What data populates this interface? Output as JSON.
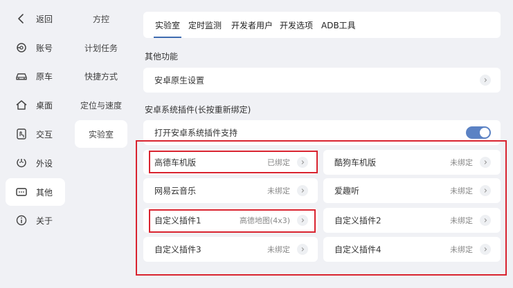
{
  "nav": {
    "items": [
      {
        "label": "返回",
        "icon": "back-icon"
      },
      {
        "label": "账号",
        "icon": "account-icon"
      },
      {
        "label": "原车",
        "icon": "car-icon"
      },
      {
        "label": "桌面",
        "icon": "home-icon"
      },
      {
        "label": "交互",
        "icon": "interaction-icon"
      },
      {
        "label": "外设",
        "icon": "peripheral-icon"
      },
      {
        "label": "其他",
        "icon": "other-icon",
        "active": true
      },
      {
        "label": "关于",
        "icon": "info-icon"
      }
    ]
  },
  "subnav": {
    "items": [
      {
        "label": "方控"
      },
      {
        "label": "计划任务"
      },
      {
        "label": "快捷方式"
      },
      {
        "label": "定位与速度"
      },
      {
        "label": "实验室",
        "active": true
      }
    ]
  },
  "tabs": [
    {
      "label": "实验室",
      "active": true
    },
    {
      "label": "定时监测"
    },
    {
      "label": "开发者用户"
    },
    {
      "label": "开发选项"
    },
    {
      "label": "ADB工具"
    }
  ],
  "other_functions": {
    "title": "其他功能",
    "android_native_settings": "安卓原生设置"
  },
  "plugins": {
    "title": "安卓系统插件(长按重新绑定)",
    "enable_label": "打开安卓系统插件支持",
    "enable_on": true,
    "items": [
      {
        "label": "高德车机版",
        "value": "已绑定"
      },
      {
        "label": "酷狗车机版",
        "value": "未绑定"
      },
      {
        "label": "网易云音乐",
        "value": "未绑定"
      },
      {
        "label": "爱趣听",
        "value": "未绑定"
      },
      {
        "label": "自定义插件1",
        "value": "高德地图(4x3)"
      },
      {
        "label": "自定义插件2",
        "value": "未绑定"
      },
      {
        "label": "自定义插件3",
        "value": "未绑定"
      },
      {
        "label": "自定义插件4",
        "value": "未绑定"
      }
    ]
  },
  "colors": {
    "accent": "#3e6bb0",
    "toggle_on": "#5b82c4",
    "highlight_box": "#d9232f",
    "background": "#f0f1f5"
  }
}
